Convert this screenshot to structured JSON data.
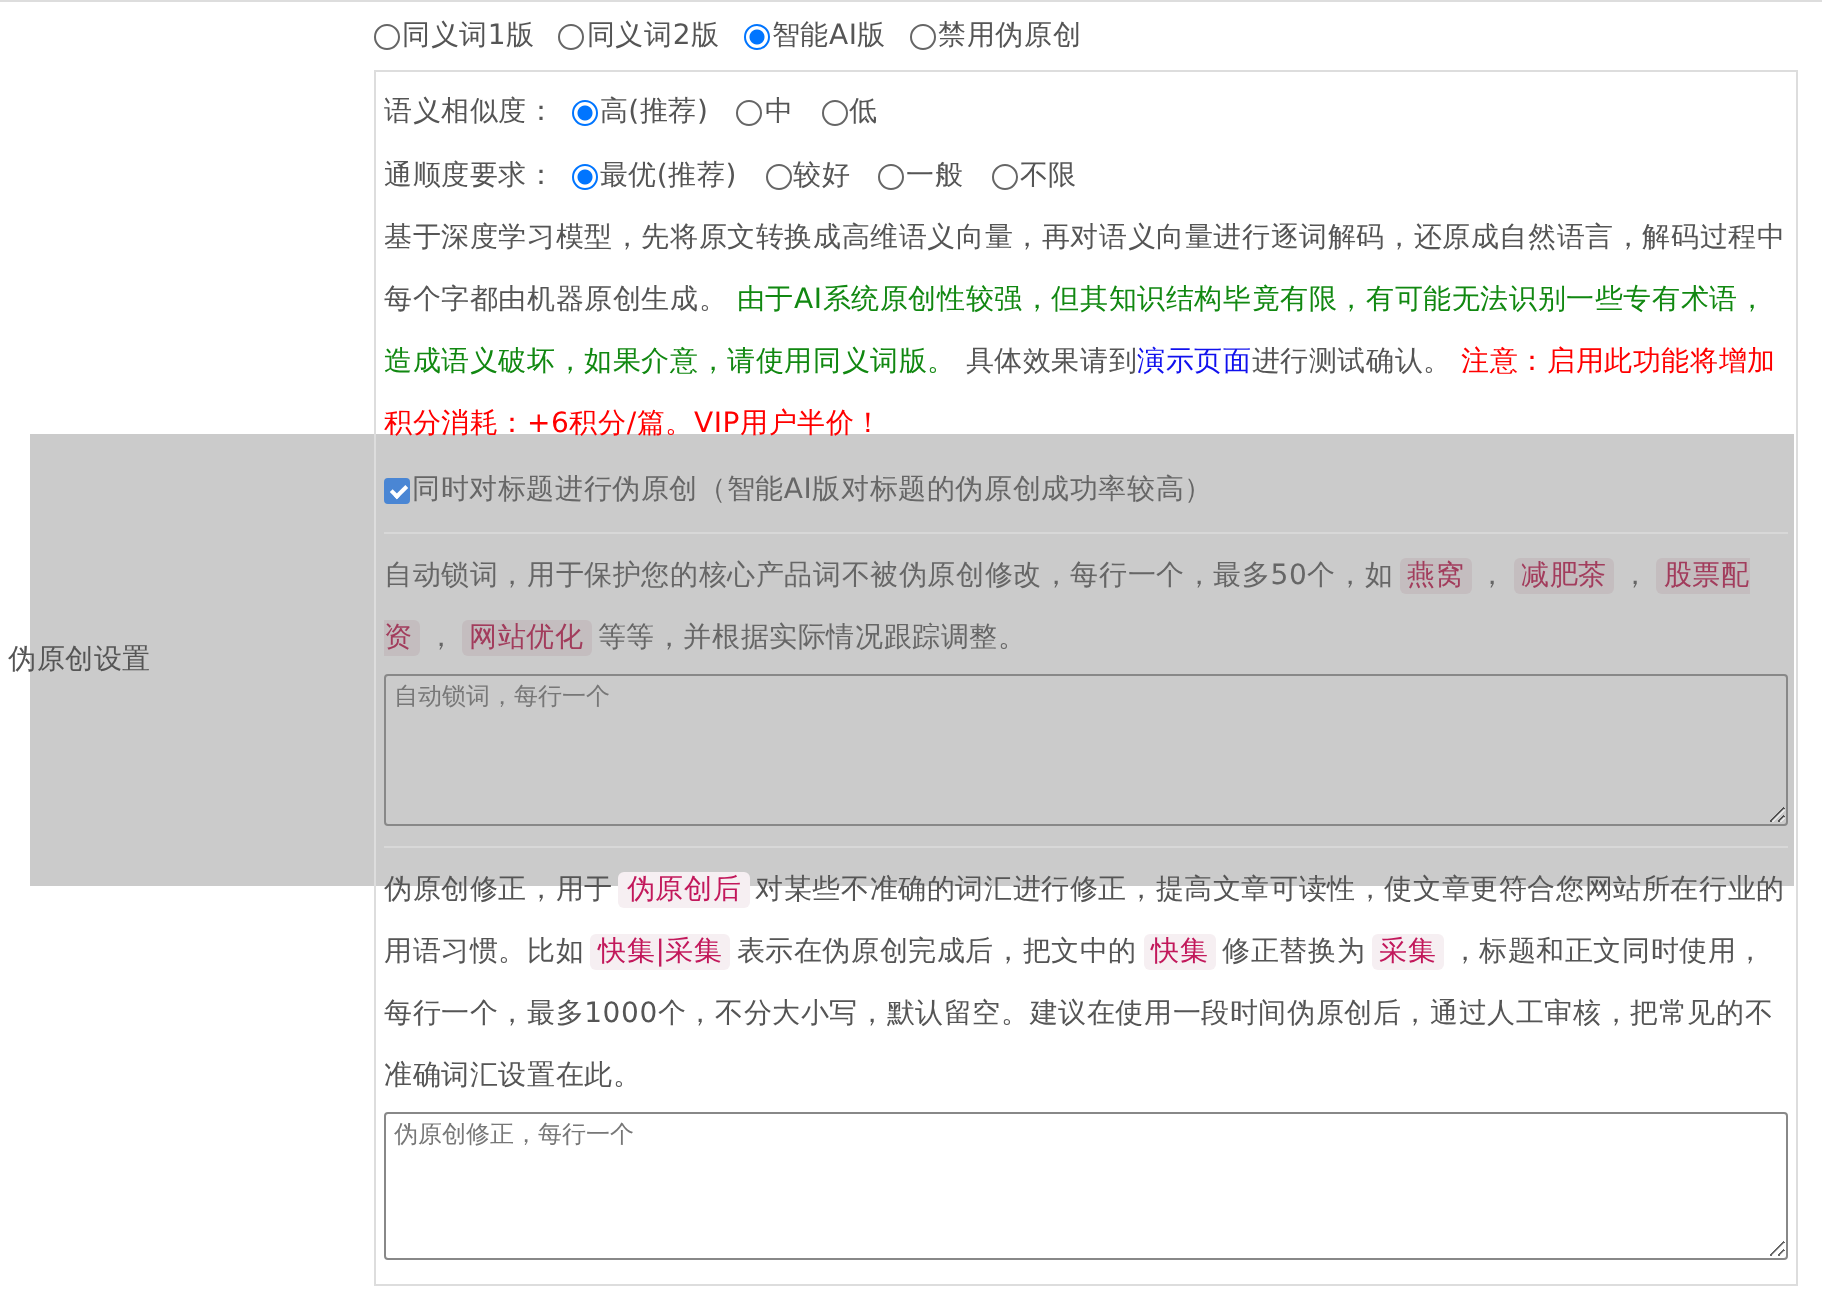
{
  "section_label": "伪原创设置",
  "mode_options": [
    {
      "label": "同义词1版",
      "selected": false
    },
    {
      "label": "同义词2版",
      "selected": false
    },
    {
      "label": "智能AI版",
      "selected": true
    },
    {
      "label": "禁用伪原创",
      "selected": false
    }
  ],
  "similarity": {
    "label": "语义相似度：",
    "options": [
      {
        "label": "高(推荐)",
        "selected": true
      },
      {
        "label": "中",
        "selected": false
      },
      {
        "label": "低",
        "selected": false
      }
    ]
  },
  "fluency": {
    "label": "通顺度要求：",
    "options": [
      {
        "label": "最优(推荐)",
        "selected": true
      },
      {
        "label": "较好",
        "selected": false
      },
      {
        "label": "一般",
        "selected": false
      },
      {
        "label": "不限",
        "selected": false
      }
    ]
  },
  "description": [
    {
      "kind": "plain",
      "text": "基于深度学习模型，先将原文转换成高维语义向量，再对语义向量进行逐词解码，还原成自然语言，解码过程中每个字都由机器原创生成。 "
    },
    {
      "kind": "note",
      "text": "由于AI系统原创性较强，但其知识结构毕竟有限，有可能无法识别一些专有术语，造成语义破坏，如果介意，请使用同义词版。"
    },
    {
      "kind": "plain",
      "text": " 具体效果请到"
    },
    {
      "kind": "link",
      "text": "演示页面"
    },
    {
      "kind": "plain",
      "text": "进行测试确认。 "
    },
    {
      "kind": "warning",
      "text": "注意：启用此功能将增加积分消耗：+6积分/篇。VIP用户半价！"
    }
  ],
  "title_checkbox": {
    "label": "同时对标题进行伪原创（智能AI版对标题的伪原创成功率较高）",
    "checked": true
  },
  "lock_words": {
    "segments": [
      {
        "kind": "plain",
        "text": "自动锁词，用于保护您的核心产品词不被伪原创修改，每行一个，最多50个，如"
      },
      {
        "kind": "tag",
        "text": "燕窝"
      },
      {
        "kind": "plain",
        "text": "，"
      },
      {
        "kind": "tag",
        "text": "减肥茶"
      },
      {
        "kind": "plain",
        "text": "，"
      },
      {
        "kind": "tag",
        "text": "股票配资"
      },
      {
        "kind": "plain",
        "text": "，"
      },
      {
        "kind": "tag",
        "text": "网站优化"
      },
      {
        "kind": "plain",
        "text": "等等，并根据实际情况跟踪调整。"
      }
    ],
    "placeholder": "自动锁词，每行一个"
  },
  "correction": {
    "segments": [
      {
        "kind": "plain",
        "text": "伪原创修正，用于"
      },
      {
        "kind": "tag",
        "text": "伪原创后"
      },
      {
        "kind": "plain",
        "text": "对某些不准确的词汇进行修正，提高文章可读性，使文章更符合您网站所在行业的用语习惯。比如"
      },
      {
        "kind": "tag",
        "text": "快集|采集"
      },
      {
        "kind": "plain",
        "text": "表示在伪原创完成后，把文中的"
      },
      {
        "kind": "tag",
        "text": "快集"
      },
      {
        "kind": "plain",
        "text": "修正替换为"
      },
      {
        "kind": "tag",
        "text": "采集"
      },
      {
        "kind": "plain",
        "text": "，标题和正文同时使用，每行一个，最多1000个，不分大小写，默认留空。建议在使用一段时间伪原创后，通过人工审核，把常见的不准确词汇设置在此。"
      }
    ],
    "placeholder": "伪原创修正，每行一个"
  }
}
